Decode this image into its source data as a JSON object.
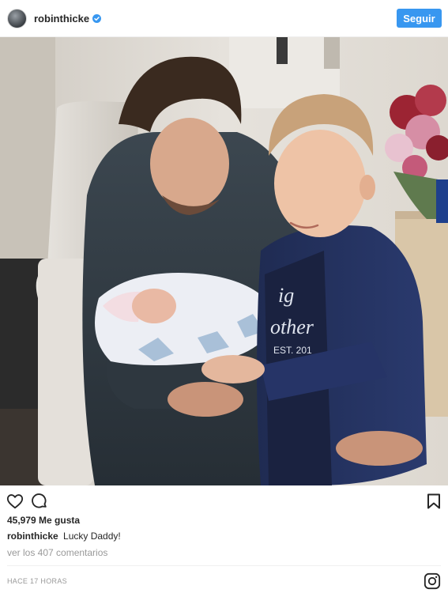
{
  "header": {
    "username": "robinthicke",
    "follow_label": "Seguir"
  },
  "post": {
    "image_icon": "photo",
    "likes": "45,979 Me gusta",
    "caption_user": "robinthicke",
    "caption_text": "Lucky Daddy!",
    "comments_link": "ver los 407 comentarios",
    "timestamp": "HACE 17 HORAS"
  },
  "shirt_print": {
    "line1": "ig",
    "line2": "other",
    "line3": "EST. 201"
  },
  "colors": {
    "accent": "#3897f0",
    "verified": "#3897f0",
    "text": "#262626",
    "muted": "#999999"
  },
  "icons": [
    "heart-icon",
    "comment-icon",
    "bookmark-icon",
    "instagram-icon",
    "verified-badge-icon"
  ]
}
